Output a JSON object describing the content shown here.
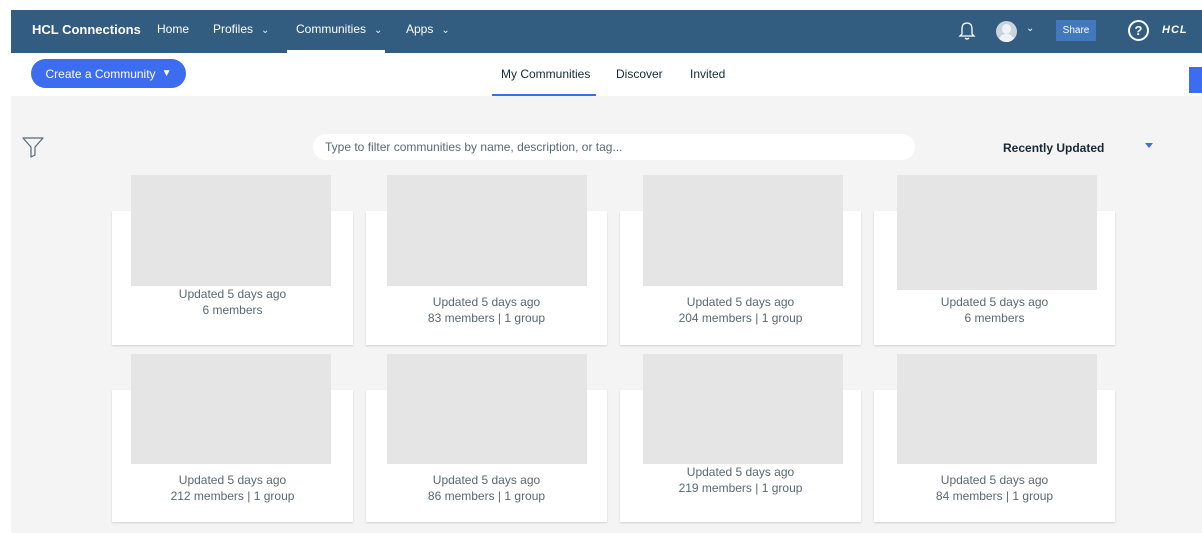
{
  "header": {
    "brand": "HCL Connections",
    "nav": [
      {
        "label": "Home",
        "chevron": false
      },
      {
        "label": "Profiles",
        "chevron": true
      },
      {
        "label": "Communities",
        "chevron": true,
        "active": true
      },
      {
        "label": "Apps",
        "chevron": true
      }
    ],
    "share_label": "Share",
    "help_label": "?",
    "logo_text": "HCL",
    "icons": [
      "bell-icon",
      "avatar",
      "help-icon"
    ]
  },
  "toolbar": {
    "create_label": "Create a Community",
    "tabs": [
      {
        "label": "My Communities",
        "active": true
      },
      {
        "label": "Discover"
      },
      {
        "label": "Invited"
      }
    ]
  },
  "filter": {
    "placeholder": "Type to filter communities by name, description, or tag...",
    "sort_label": "Recently Updated"
  },
  "cards": [
    {
      "updated": "Updated 5 days ago",
      "members": "6 members"
    },
    {
      "updated": "Updated 5 days ago",
      "members": "83 members | 1 group"
    },
    {
      "updated": "Updated 5 days ago",
      "members": "204 members | 1 group"
    },
    {
      "updated": "Updated 5 days ago",
      "members": "6 members"
    },
    {
      "updated": "Updated 5 days ago",
      "members": "212 members | 1 group"
    },
    {
      "updated": "Updated 5 days ago",
      "members": "86 members | 1 group"
    },
    {
      "updated": "Updated 5 days ago",
      "members": "219 members | 1 group"
    },
    {
      "updated": "Updated 5 days ago",
      "members": "84 members | 1 group"
    }
  ],
  "colors": {
    "navbar": "#325c80",
    "accent": "#3c6df0",
    "content_bg": "#f4f4f4"
  }
}
